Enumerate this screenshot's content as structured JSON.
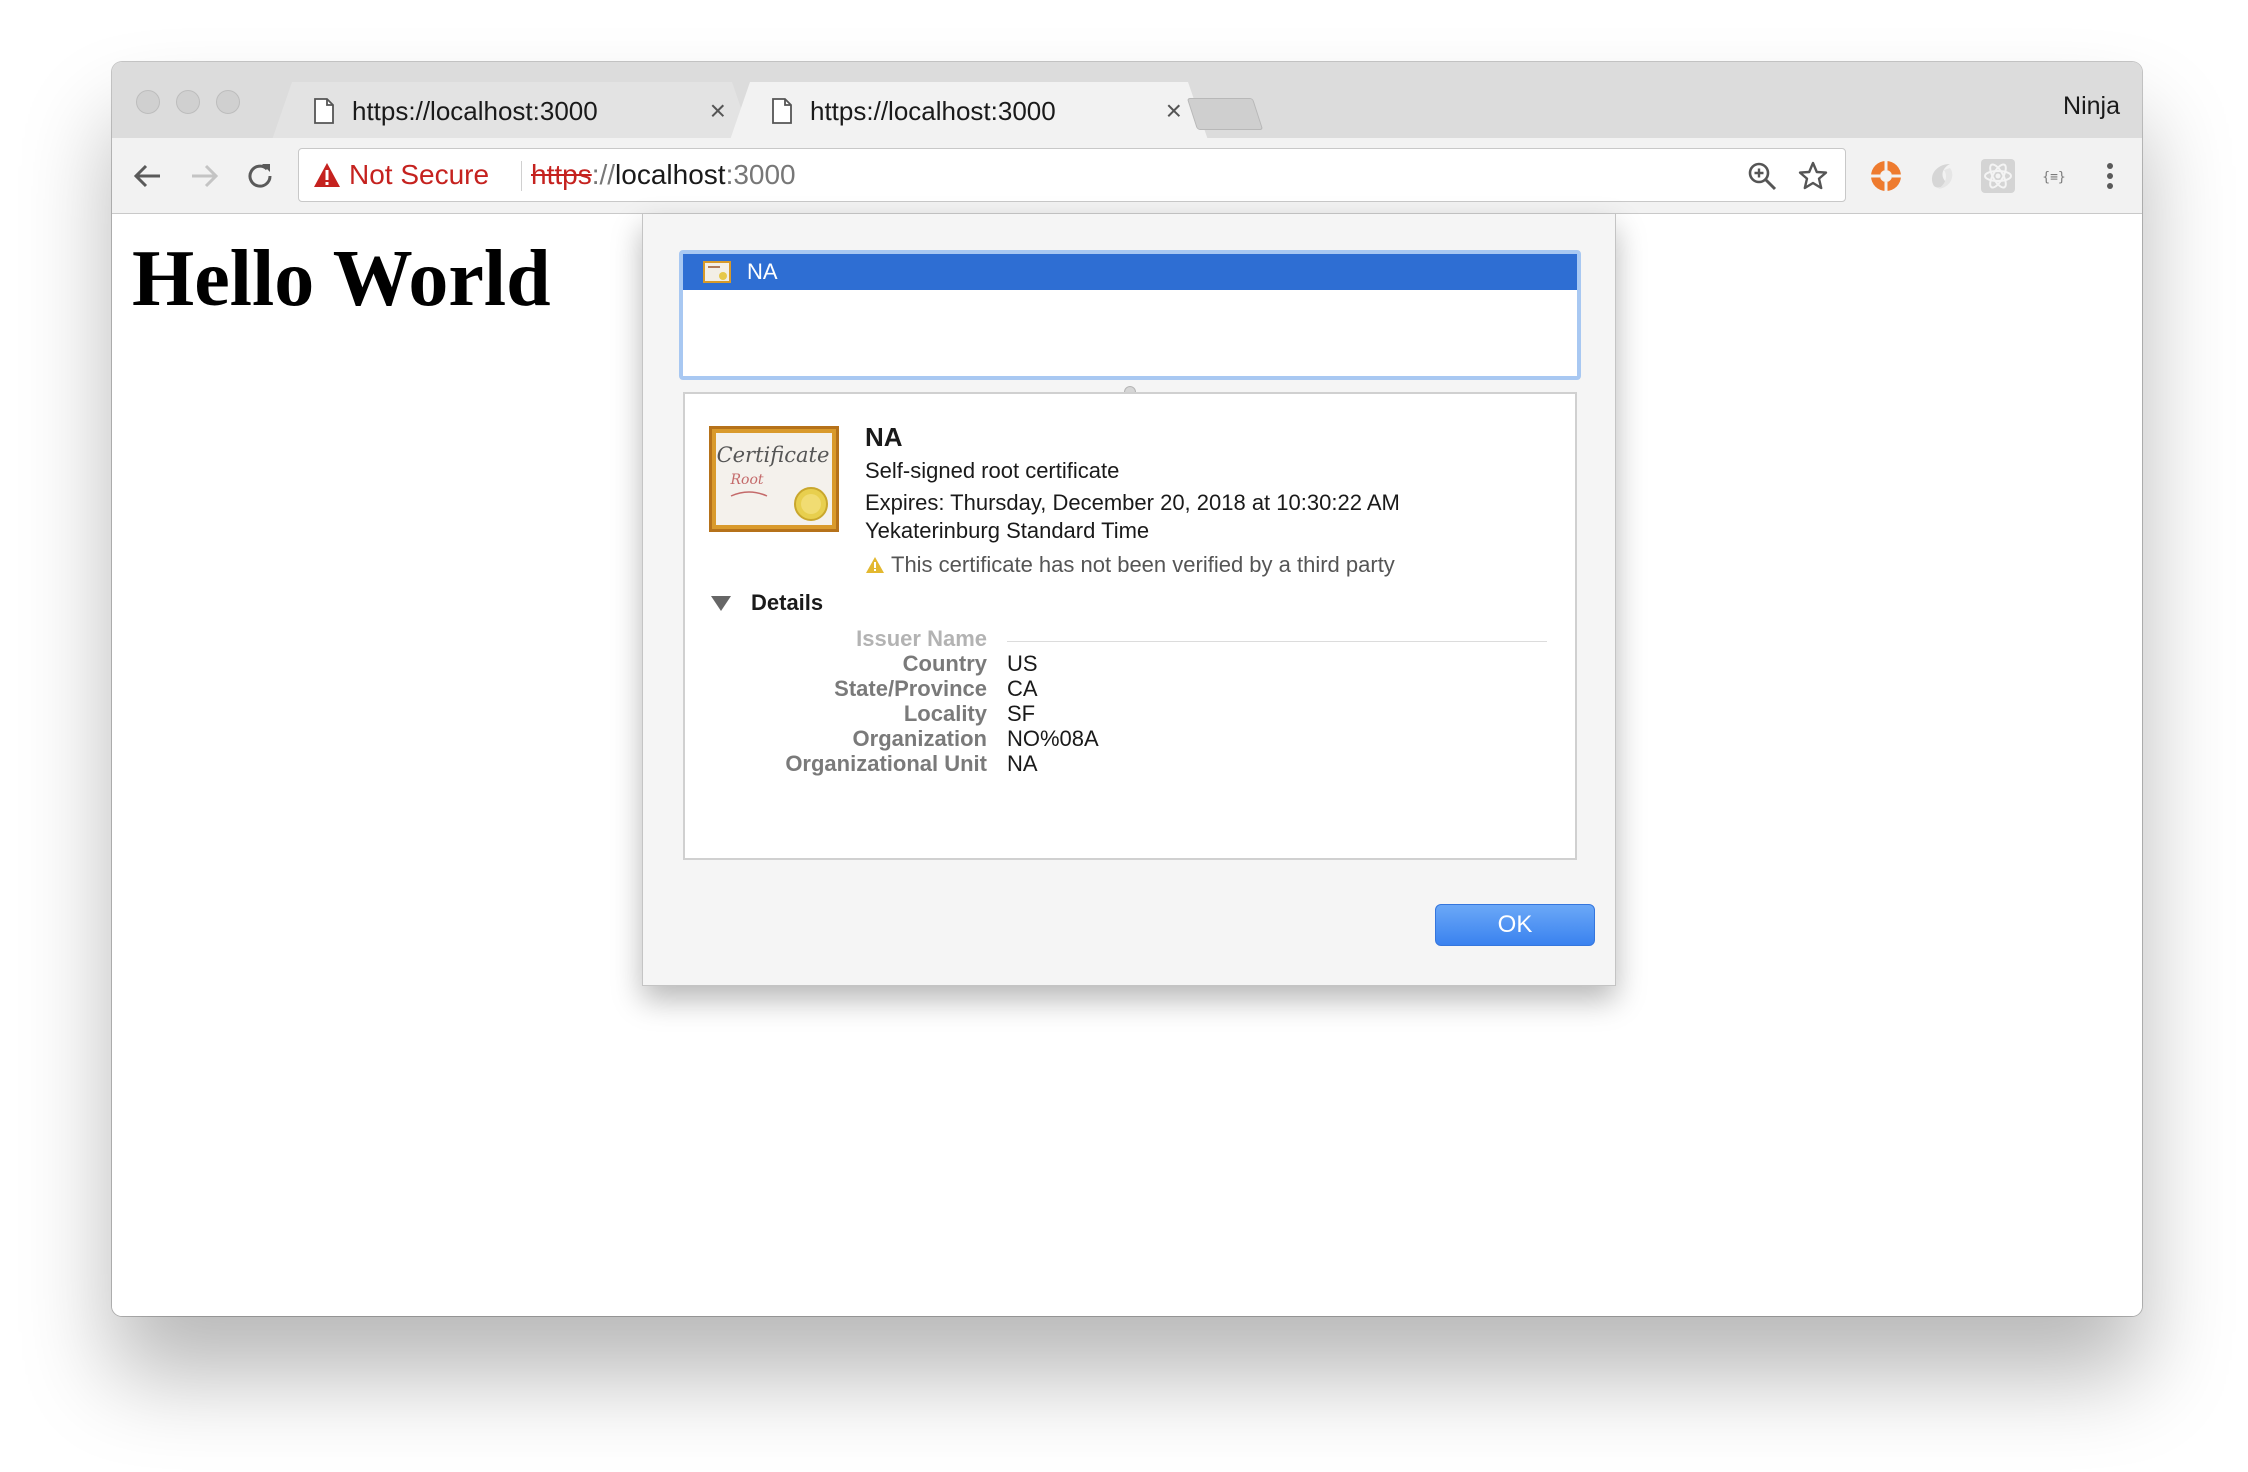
{
  "browser": {
    "tabs": [
      {
        "title": "https://localhost:3000",
        "active": false
      },
      {
        "title": "https://localhost:3000",
        "active": true
      }
    ],
    "profile_name": "Ninja",
    "security_label": "Not Secure",
    "url": {
      "scheme": "https",
      "separator": "://",
      "host": "localhost",
      "port": ":3000"
    },
    "toolbar_icons": [
      "back-arrow-icon",
      "forward-arrow-icon",
      "reload-icon",
      "zoom-icon",
      "bookmark-star-icon"
    ],
    "extension_icons": [
      "orange-lifebuoy-icon",
      "grey-swirl-icon",
      "react-atom-icon",
      "json-braces-icon",
      "menu-dots-icon"
    ],
    "colors": {
      "not_secure_red": "#c5221f",
      "selection_blue": "#2e6ed3",
      "ok_button_blue": "#3a82ef"
    }
  },
  "page": {
    "heading": "Hello World"
  },
  "certificate_sheet": {
    "list": [
      {
        "label": "NA",
        "selected": true
      }
    ],
    "certificate": {
      "name": "NA",
      "type": "Self-signed root certificate",
      "expires": "Expires: Thursday, December 20, 2018 at 10:30:22 AM",
      "timezone": "Yekaterinburg Standard Time",
      "warning": "This certificate has not been verified by a third party"
    },
    "details_label": "Details",
    "section_title": "Issuer Name",
    "fields": [
      {
        "label": "Country",
        "value": "US"
      },
      {
        "label": "State/Province",
        "value": "CA"
      },
      {
        "label": "Locality",
        "value": "SF"
      },
      {
        "label": "Organization",
        "value": "NO%08A"
      },
      {
        "label": "Organizational Unit",
        "value": "NA"
      }
    ],
    "ok_label": "OK",
    "image_text": {
      "line1": "Certificate",
      "line2": "Root"
    }
  }
}
